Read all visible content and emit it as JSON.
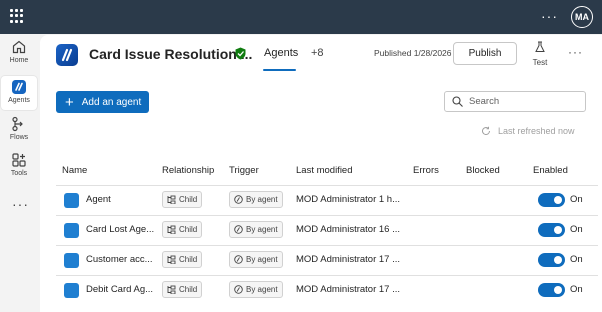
{
  "topbar": {
    "avatar_initials": "MA"
  },
  "rail": {
    "items": [
      {
        "label": "Home",
        "icon": "home-icon"
      },
      {
        "label": "Agents",
        "icon": "agents-icon",
        "active": true
      },
      {
        "label": "Flows",
        "icon": "flows-icon"
      },
      {
        "label": "Tools",
        "icon": "tools-icon"
      }
    ]
  },
  "header": {
    "title": "Card Issue Resolution ...",
    "tab_agents": "Agents",
    "tab_more": "+8",
    "published": "Published 1/28/2026",
    "publish_label": "Publish",
    "test_label": "Test"
  },
  "toolbar": {
    "add_label": "Add an agent",
    "search_placeholder": "Search",
    "refresh_label": "Last refreshed now"
  },
  "table": {
    "headers": {
      "name": "Name",
      "relationship": "Relationship",
      "trigger": "Trigger",
      "modified": "Last modified",
      "errors": "Errors",
      "blocked": "Blocked",
      "enabled": "Enabled"
    },
    "rows": [
      {
        "name": "Agent",
        "relationship": "Child",
        "trigger": "By agent",
        "modified": "MOD Administrator  1 h...",
        "enabled": "On"
      },
      {
        "name": "Card Lost Age...",
        "relationship": "Child",
        "trigger": "By agent",
        "modified": "MOD Administrator  16 ...",
        "enabled": "On"
      },
      {
        "name": "Customer acc...",
        "relationship": "Child",
        "trigger": "By agent",
        "modified": "MOD Administrator  17 ...",
        "enabled": "On"
      },
      {
        "name": "Debit Card Ag...",
        "relationship": "Child",
        "trigger": "By agent",
        "modified": "MOD Administrator  17 ...",
        "enabled": "On"
      }
    ]
  },
  "colors": {
    "accent": "#0f6cbd",
    "topbar": "#2b3a4a",
    "shield": "#107c10"
  }
}
